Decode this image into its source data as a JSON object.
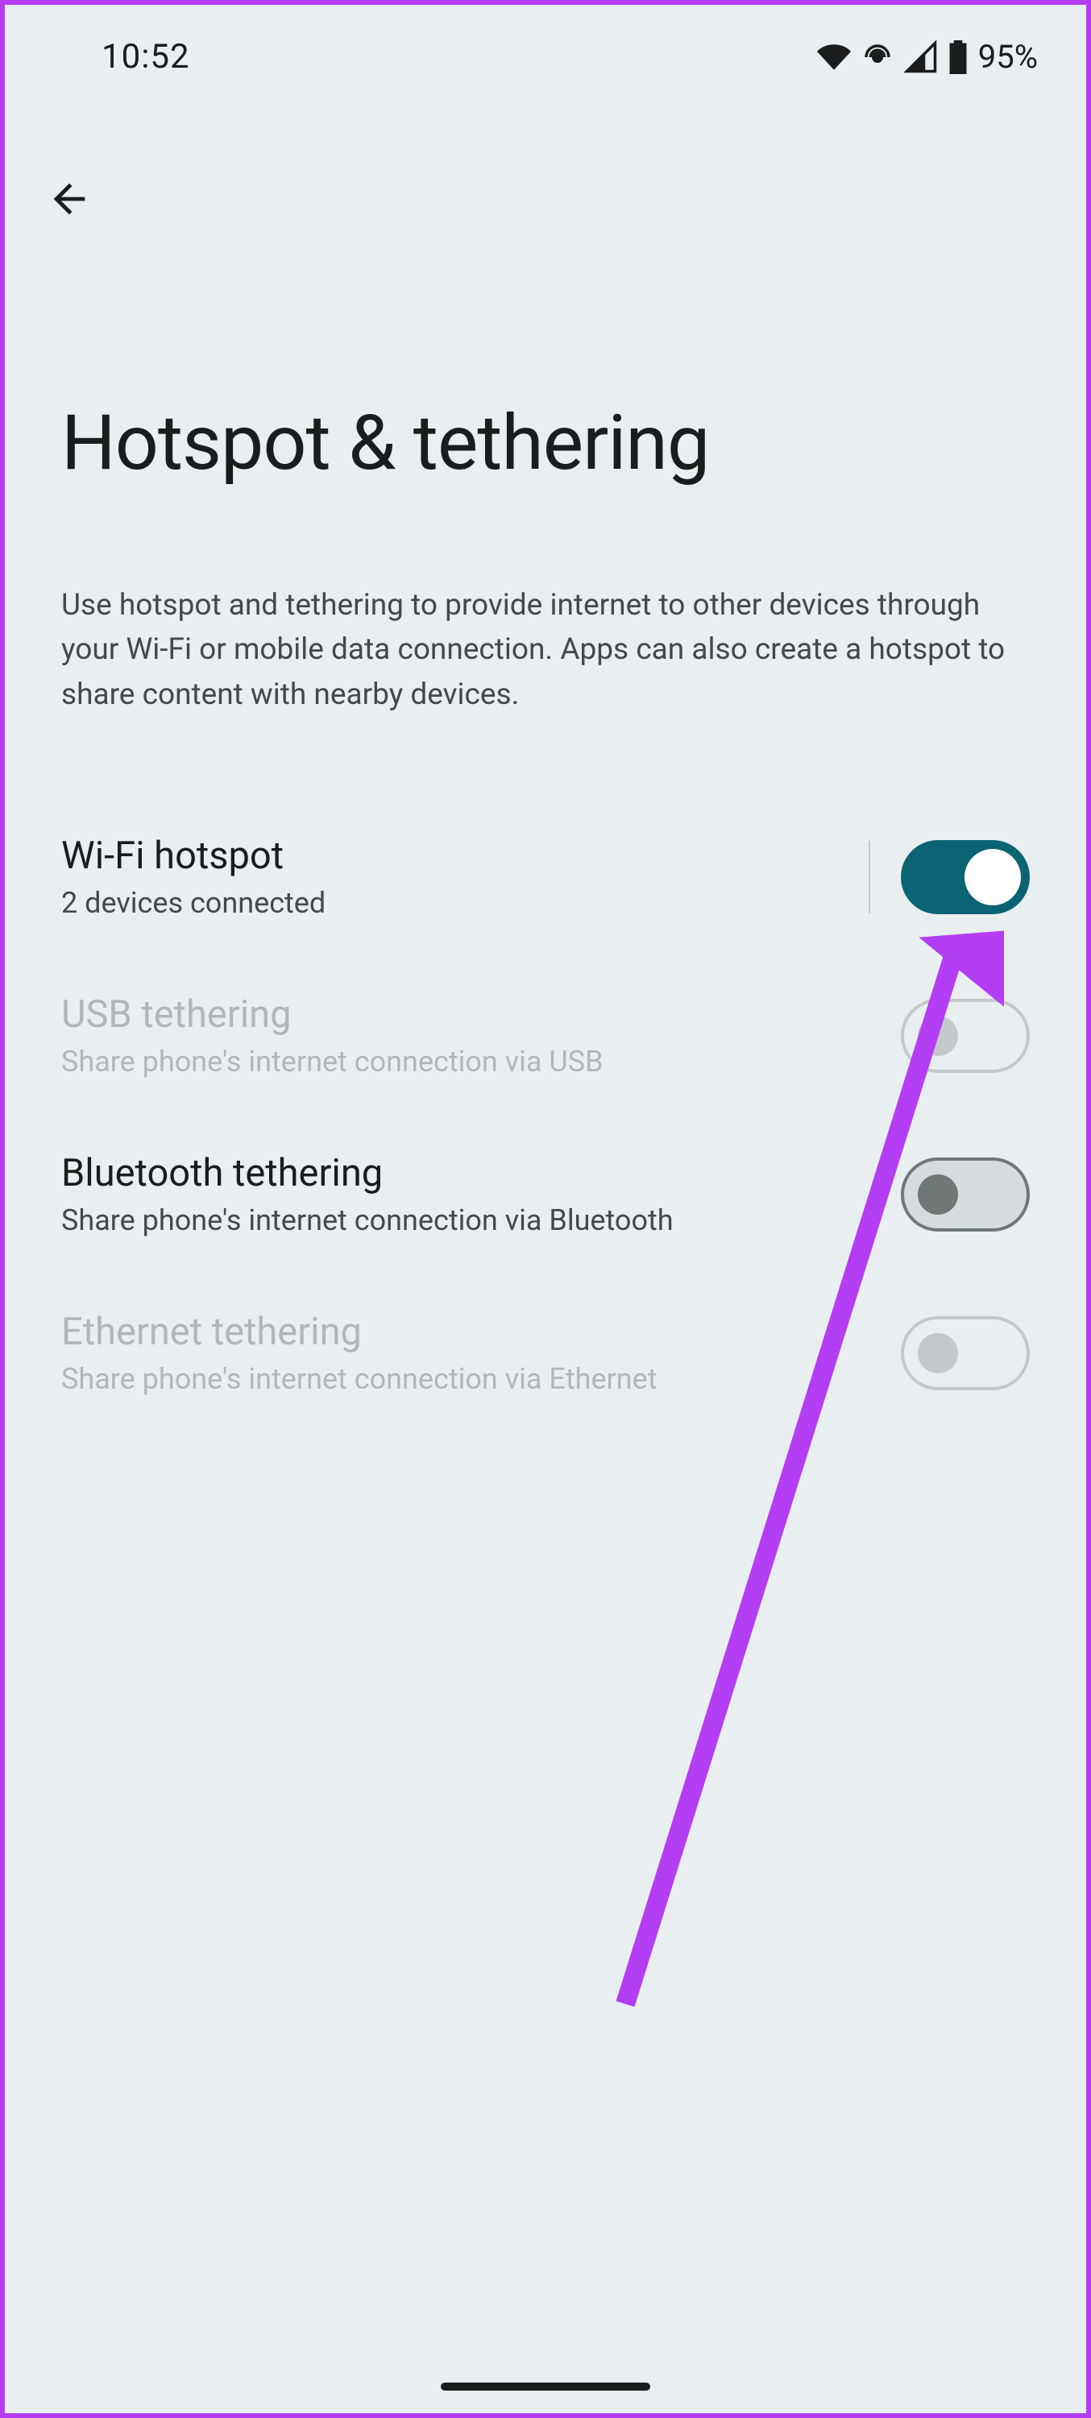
{
  "status_bar": {
    "time": "10:52",
    "battery_pct": "95%"
  },
  "page": {
    "title": "Hotspot & tethering",
    "description": "Use hotspot and tethering to provide internet to other devices through your Wi-Fi or mobile data connection. Apps can also create a hotspot to share content with nearby devices."
  },
  "settings": {
    "wifi_hotspot": {
      "title": "Wi-Fi hotspot",
      "subtitle": "2 devices connected",
      "on": true,
      "enabled": true
    },
    "usb_tethering": {
      "title": "USB tethering",
      "subtitle": "Share phone's internet connection via USB",
      "on": false,
      "enabled": false
    },
    "bluetooth_tethering": {
      "title": "Bluetooth tethering",
      "subtitle": "Share phone's internet connection via Bluetooth",
      "on": false,
      "enabled": true
    },
    "ethernet_tethering": {
      "title": "Ethernet tethering",
      "subtitle": "Share phone's internet connection via Ethernet",
      "on": false,
      "enabled": false
    }
  },
  "annotation": {
    "arrow_color": "#b33ef3"
  }
}
